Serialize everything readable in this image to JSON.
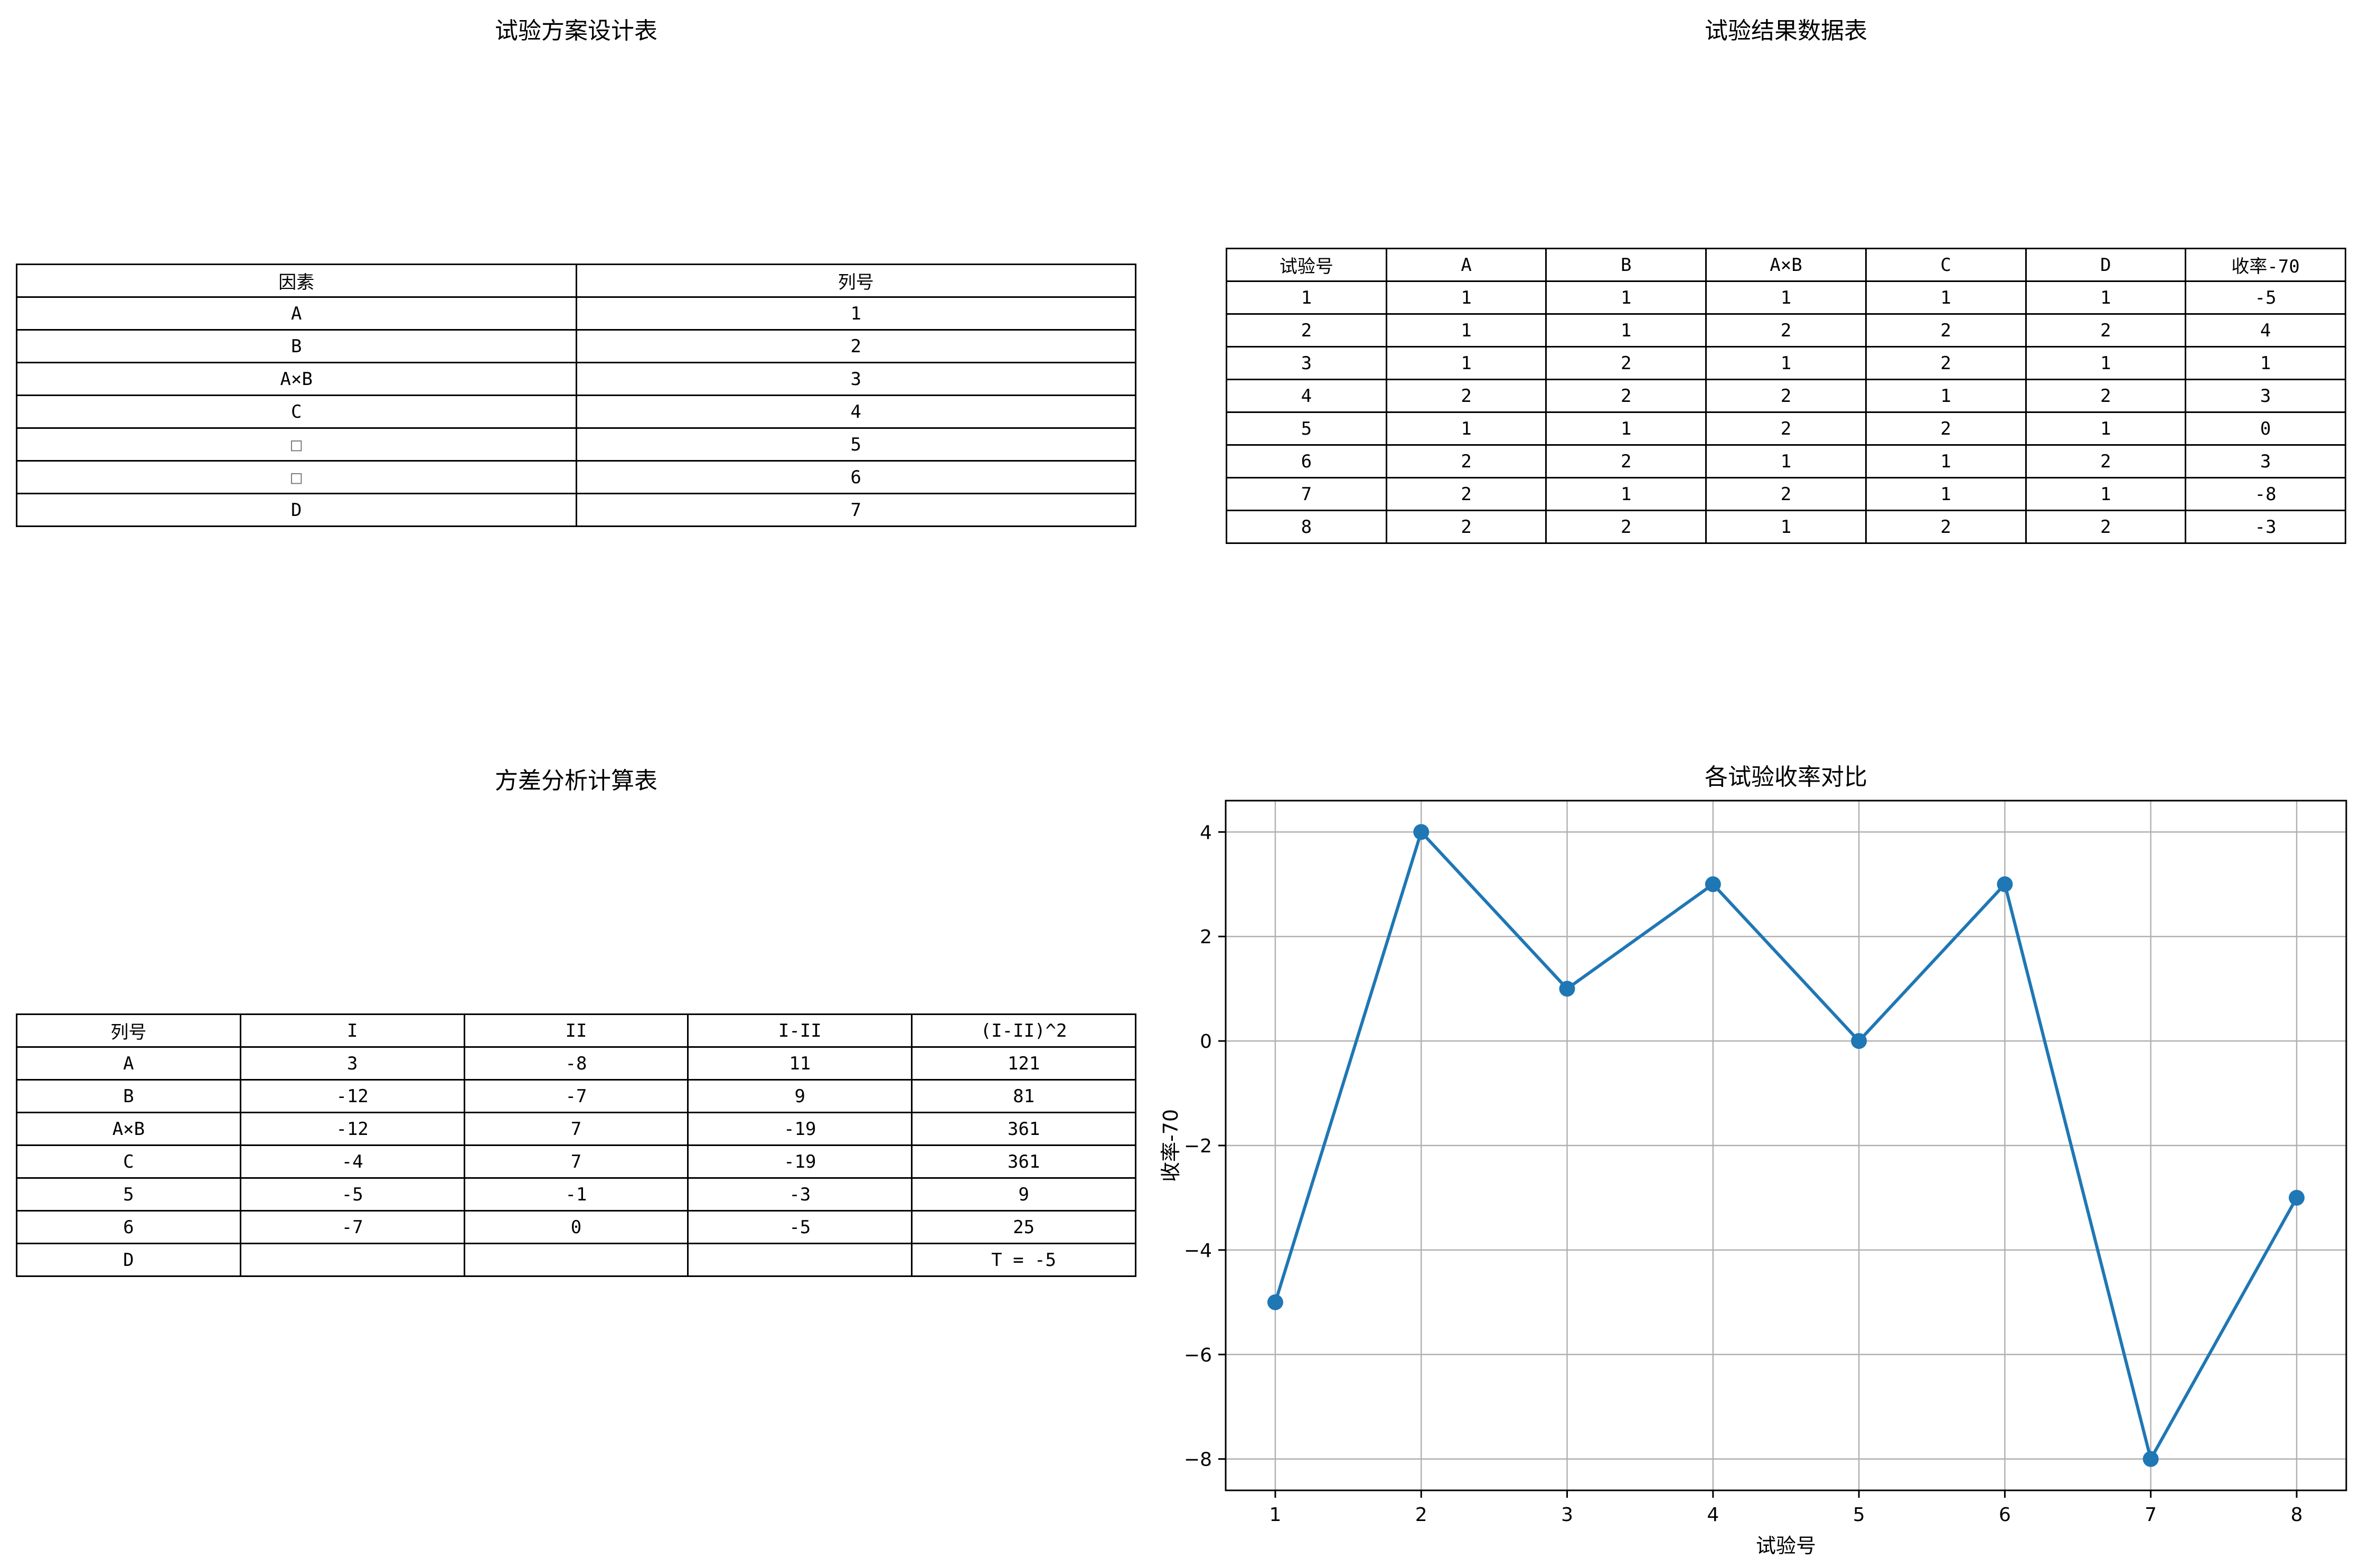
{
  "design_table": {
    "title": "试验方案设计表",
    "headers": [
      "因素",
      "列号"
    ],
    "rows": [
      [
        "A",
        "1"
      ],
      [
        "B",
        "2"
      ],
      [
        "A×B",
        "3"
      ],
      [
        "C",
        "4"
      ],
      [
        "□",
        "5"
      ],
      [
        "□",
        "6"
      ],
      [
        "D",
        "7"
      ]
    ]
  },
  "result_table": {
    "title": "试验结果数据表",
    "headers": [
      "试验号",
      "A",
      "B",
      "A×B",
      "C",
      "D",
      "收率-70"
    ],
    "rows": [
      [
        "1",
        "1",
        "1",
        "1",
        "1",
        "1",
        "-5"
      ],
      [
        "2",
        "1",
        "1",
        "2",
        "2",
        "2",
        "4"
      ],
      [
        "3",
        "1",
        "2",
        "1",
        "2",
        "1",
        "1"
      ],
      [
        "4",
        "2",
        "2",
        "2",
        "1",
        "2",
        "3"
      ],
      [
        "5",
        "1",
        "1",
        "2",
        "2",
        "1",
        "0"
      ],
      [
        "6",
        "2",
        "2",
        "1",
        "1",
        "2",
        "3"
      ],
      [
        "7",
        "2",
        "1",
        "2",
        "1",
        "1",
        "-8"
      ],
      [
        "8",
        "2",
        "2",
        "1",
        "2",
        "2",
        "-3"
      ]
    ]
  },
  "anova_table": {
    "title": "方差分析计算表",
    "headers": [
      "列号",
      "I",
      "II",
      "I-II",
      "(I-II)^2"
    ],
    "rows": [
      [
        "A",
        "3",
        "-8",
        "11",
        "121"
      ],
      [
        "B",
        "-12",
        "-7",
        "9",
        "81"
      ],
      [
        "A×B",
        "-12",
        "7",
        "-19",
        "361"
      ],
      [
        "C",
        "-4",
        "7",
        "-19",
        "361"
      ],
      [
        "5",
        "-5",
        "-1",
        "-3",
        "9"
      ],
      [
        "6",
        "-7",
        "0",
        "-5",
        "25"
      ],
      [
        "D",
        "",
        "",
        "",
        "T = -5"
      ]
    ]
  },
  "chart_data": [
    {
      "type": "table",
      "title": "试验方案设计表",
      "columns": [
        "因素",
        "列号"
      ],
      "rows": [
        [
          "A",
          "1"
        ],
        [
          "B",
          "2"
        ],
        [
          "A×B",
          "3"
        ],
        [
          "C",
          "4"
        ],
        [
          "□",
          "5"
        ],
        [
          "□",
          "6"
        ],
        [
          "D",
          "7"
        ]
      ]
    },
    {
      "type": "table",
      "title": "试验结果数据表",
      "columns": [
        "试验号",
        "A",
        "B",
        "A×B",
        "C",
        "D",
        "收率-70"
      ],
      "rows": [
        [
          "1",
          "1",
          "1",
          "1",
          "1",
          "1",
          "-5"
        ],
        [
          "2",
          "1",
          "1",
          "2",
          "2",
          "2",
          "4"
        ],
        [
          "3",
          "1",
          "2",
          "1",
          "2",
          "1",
          "1"
        ],
        [
          "4",
          "2",
          "2",
          "2",
          "1",
          "2",
          "3"
        ],
        [
          "5",
          "1",
          "1",
          "2",
          "2",
          "1",
          "0"
        ],
        [
          "6",
          "2",
          "2",
          "1",
          "1",
          "2",
          "3"
        ],
        [
          "7",
          "2",
          "1",
          "2",
          "1",
          "1",
          "-8"
        ],
        [
          "8",
          "2",
          "2",
          "1",
          "2",
          "2",
          "-3"
        ]
      ]
    },
    {
      "type": "table",
      "title": "方差分析计算表",
      "columns": [
        "列号",
        "I",
        "II",
        "I-II",
        "(I-II)^2"
      ],
      "rows": [
        [
          "A",
          "3",
          "-8",
          "11",
          "121"
        ],
        [
          "B",
          "-12",
          "-7",
          "9",
          "81"
        ],
        [
          "A×B",
          "-12",
          "7",
          "-19",
          "361"
        ],
        [
          "C",
          "-4",
          "7",
          "-19",
          "361"
        ],
        [
          "5",
          "-5",
          "-1",
          "-3",
          "9"
        ],
        [
          "6",
          "-7",
          "0",
          "-5",
          "25"
        ],
        [
          "D",
          "",
          "",
          "",
          "T = -5"
        ]
      ]
    },
    {
      "type": "line",
      "title": "各试验收率对比",
      "xlabel": "试验号",
      "ylabel": "收率-70",
      "x": [
        1,
        2,
        3,
        4,
        5,
        6,
        7,
        8
      ],
      "series": [
        {
          "values": [
            -5,
            4,
            1,
            3,
            0,
            3,
            -8,
            -3
          ]
        }
      ],
      "xticks": [
        "1",
        "2",
        "3",
        "4",
        "5",
        "6",
        "7",
        "8"
      ],
      "yticks": [
        "−8",
        "−6",
        "−4",
        "−2",
        "0",
        "2",
        "4"
      ],
      "xlim": [
        0.66,
        8.34
      ],
      "ylim": [
        -8.6,
        4.6
      ],
      "grid": true,
      "marker": "circle",
      "line_color": "#1f77b4"
    }
  ]
}
